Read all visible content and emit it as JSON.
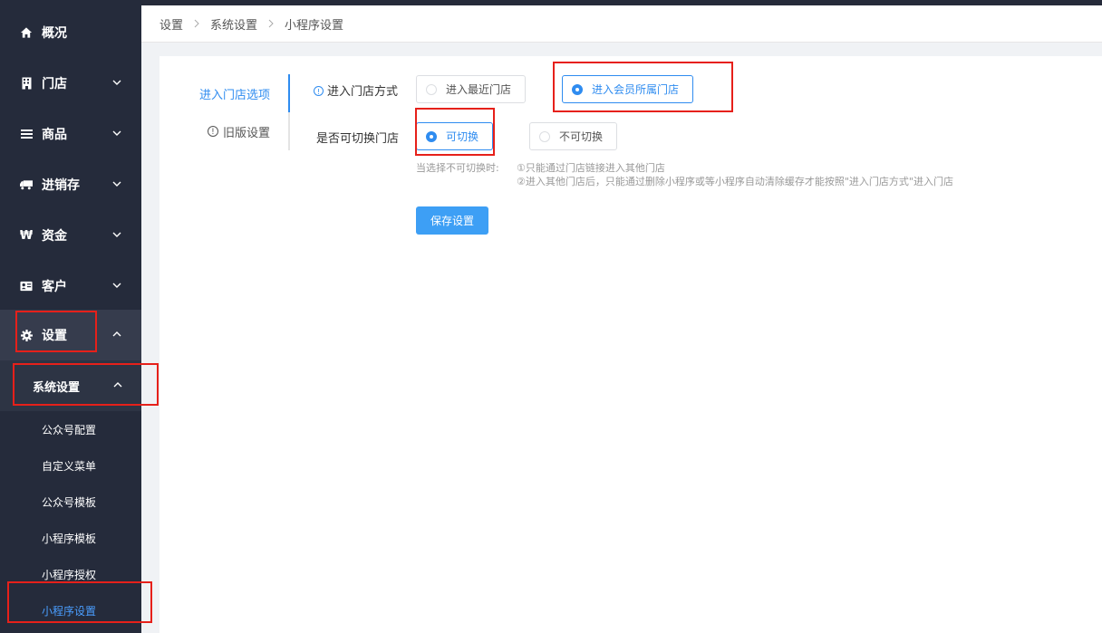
{
  "sidebar": {
    "items": [
      {
        "label": "概况",
        "icon": "home-icon"
      },
      {
        "label": "门店",
        "icon": "building-icon"
      },
      {
        "label": "商品",
        "icon": "menu-icon"
      },
      {
        "label": "进销存",
        "icon": "truck-icon"
      },
      {
        "label": "资金",
        "icon": "currency-icon"
      },
      {
        "label": "客户",
        "icon": "id-card-icon"
      },
      {
        "label": "设置",
        "icon": "gear-icon"
      }
    ],
    "submenu_title": "系统设置",
    "submenu_items": [
      {
        "label": "公众号配置"
      },
      {
        "label": "自定义菜单"
      },
      {
        "label": "公众号模板"
      },
      {
        "label": "小程序模板"
      },
      {
        "label": "小程序授权"
      },
      {
        "label": "小程序设置"
      }
    ]
  },
  "breadcrumb": [
    "设置",
    "系统设置",
    "小程序设置"
  ],
  "tabs": [
    {
      "label": "进入门店选项"
    },
    {
      "label": "旧版设置"
    }
  ],
  "form": {
    "entry_mode_label": "进入门店方式",
    "entry_options": [
      "进入最近门店",
      "进入会员所属门店"
    ],
    "entry_selected": "进入会员所属门店",
    "switch_label": "是否可切换门店",
    "switch_options": [
      "可切换",
      "不可切换"
    ],
    "switch_selected": "可切换",
    "hint_prefix": "当选择不可切换时:",
    "hint_line1": "①只能通过门店链接进入其他门店",
    "hint_line2": "②进入其他门店后，只能通过删除小程序或等小程序自动清除缓存才能按照\"进入门店方式\"进入门店",
    "save_label": "保存设置"
  },
  "colors": {
    "accent": "#2f8cf0",
    "sidebar": "#252b3b",
    "highlight": "#e6201a"
  }
}
